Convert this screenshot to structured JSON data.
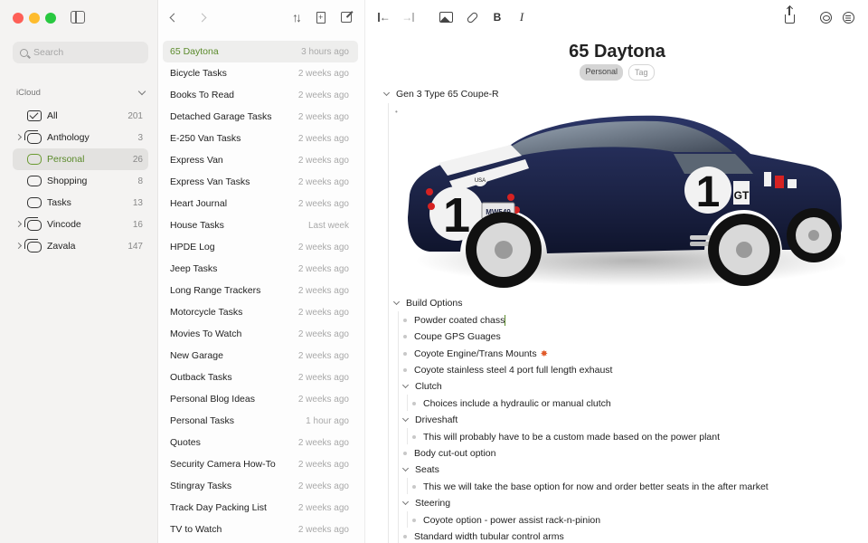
{
  "sidebar": {
    "search_placeholder": "Search",
    "group_label": "iCloud",
    "notebooks": [
      {
        "label": "All",
        "count": "201",
        "icon": "tray-icon",
        "disclosure": false,
        "active": false
      },
      {
        "label": "Anthology",
        "count": "3",
        "icon": "stack-icon",
        "disclosure": true,
        "active": false
      },
      {
        "label": "Personal",
        "count": "26",
        "icon": "notebook-icon",
        "disclosure": false,
        "active": true
      },
      {
        "label": "Shopping",
        "count": "8",
        "icon": "notebook-icon",
        "disclosure": false,
        "active": false
      },
      {
        "label": "Tasks",
        "count": "13",
        "icon": "notebook-icon",
        "disclosure": false,
        "active": false
      },
      {
        "label": "Vincode",
        "count": "16",
        "icon": "stack-icon",
        "disclosure": true,
        "active": false
      },
      {
        "label": "Zavala",
        "count": "147",
        "icon": "stack-icon",
        "disclosure": true,
        "active": false
      }
    ]
  },
  "notes": [
    {
      "title": "65 Daytona",
      "time": "3 hours ago",
      "active": true
    },
    {
      "title": "Bicycle Tasks",
      "time": "2 weeks ago"
    },
    {
      "title": "Books To Read",
      "time": "2 weeks ago"
    },
    {
      "title": "Detached Garage Tasks",
      "time": "2 weeks ago"
    },
    {
      "title": "E-250 Van Tasks",
      "time": "2 weeks ago"
    },
    {
      "title": "Express Van",
      "time": "2 weeks ago"
    },
    {
      "title": "Express Van Tasks",
      "time": "2 weeks ago"
    },
    {
      "title": "Heart Journal",
      "time": "2 weeks ago"
    },
    {
      "title": "House Tasks",
      "time": "Last week"
    },
    {
      "title": "HPDE Log",
      "time": "2 weeks ago"
    },
    {
      "title": "Jeep Tasks",
      "time": "2 weeks ago"
    },
    {
      "title": "Long Range Trackers",
      "time": "2 weeks ago"
    },
    {
      "title": "Motorcycle Tasks",
      "time": "2 weeks ago"
    },
    {
      "title": "Movies To Watch",
      "time": "2 weeks ago"
    },
    {
      "title": "New Garage",
      "time": "2 weeks ago"
    },
    {
      "title": "Outback Tasks",
      "time": "2 weeks ago"
    },
    {
      "title": "Personal Blog Ideas",
      "time": "2 weeks ago"
    },
    {
      "title": "Personal Tasks",
      "time": "1 hour ago"
    },
    {
      "title": "Quotes",
      "time": "2 weeks ago"
    },
    {
      "title": "Security Camera How-To",
      "time": "2 weeks ago"
    },
    {
      "title": "Stingray Tasks",
      "time": "2 weeks ago"
    },
    {
      "title": "Track Day Packing List",
      "time": "2 weeks ago"
    },
    {
      "title": "TV to Watch",
      "time": "2 weeks ago"
    }
  ],
  "editor": {
    "title": "65 Daytona",
    "tags": [
      {
        "label": "Personal",
        "style": "filled"
      },
      {
        "label": "Tag",
        "style": "empty"
      }
    ],
    "outline": {
      "root": "Gen 3 Type 65 Coupe-R",
      "image_caption_marker": "•",
      "build_options": "Build Options",
      "item_powder": "Powder coated chass",
      "item_gps": "Coupe GPS Guages",
      "item_coyote": "Coyote Engine/Trans Mounts",
      "item_exhaust": "Coyote stainless steel 4 port full length exhaust",
      "clutch": "Clutch",
      "clutch_detail": "Choices include a hydraulic or manual clutch",
      "driveshaft": "Driveshaft",
      "driveshaft_detail": "This will probably have to be a custom made based on the power plant",
      "bodycut": "Body cut-out option",
      "seats": "Seats",
      "seats_detail": "This we will take the base option for now and order better seats in the after market",
      "steering": "Steering",
      "steering_detail": "Coyote option - power assist rack-n-pinion",
      "control_arms": "Standard width tubular control arms"
    },
    "car_plate": "MW549",
    "car_number": "1",
    "car_badge": "GT",
    "car_usa": "USA"
  },
  "colors": {
    "accent": "#5a8a2a",
    "car_body": "#1b2244",
    "stripe": "#f2f2f2"
  }
}
